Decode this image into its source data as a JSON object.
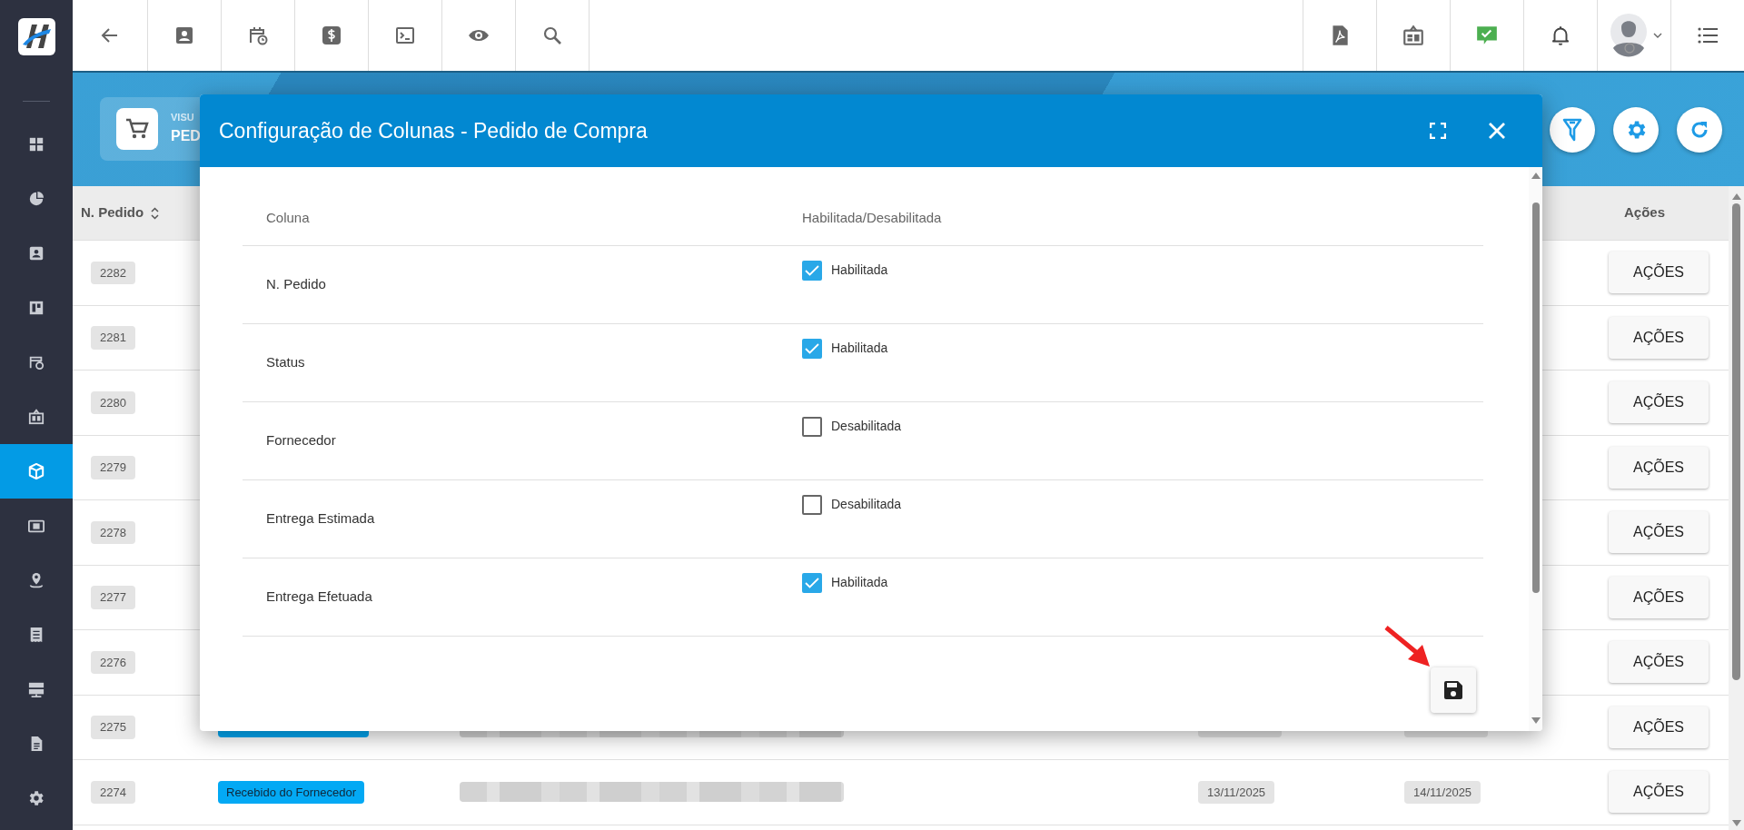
{
  "sidebar": {
    "items": [
      {
        "selected": false
      },
      {
        "selected": false
      },
      {
        "selected": false
      },
      {
        "selected": false
      },
      {
        "selected": false
      },
      {
        "selected": false
      },
      {
        "selected": true
      },
      {
        "selected": false
      },
      {
        "selected": false
      },
      {
        "selected": false
      },
      {
        "selected": false
      },
      {
        "selected": false
      },
      {
        "selected": false
      }
    ]
  },
  "banner": {
    "subtitle": "VISU",
    "title": "PED"
  },
  "table": {
    "columns": [
      "N. Pedido",
      "Ações"
    ],
    "rows": [
      {
        "number": "2282",
        "action": "AÇÕES"
      },
      {
        "number": "2281",
        "action": "AÇÕES"
      },
      {
        "number": "2280",
        "action": "AÇÕES"
      },
      {
        "number": "2279",
        "action": "AÇÕES"
      },
      {
        "number": "2278",
        "action": "AÇÕES"
      },
      {
        "number": "2277",
        "action": "AÇÕES"
      },
      {
        "number": "2276",
        "action": "AÇÕES"
      },
      {
        "number": "2275",
        "action": "AÇÕES",
        "partly_covered": true
      },
      {
        "number": "2274",
        "action": "AÇÕES",
        "status": "Recebido do Fornecedor",
        "estimated": "13/11/2025",
        "delivered": "14/11/2025"
      }
    ]
  },
  "modal": {
    "title": "Configuração de Colunas - Pedido de Compra",
    "columns": [
      "Coluna",
      "Habilitada/Desabilitada"
    ],
    "rows": [
      {
        "column": "N. Pedido",
        "checked": true,
        "state_label": "Habilitada"
      },
      {
        "column": "Status",
        "checked": true,
        "state_label": "Habilitada"
      },
      {
        "column": "Fornecedor",
        "checked": false,
        "state_label": "Desabilitada"
      },
      {
        "column": "Entrega Estimada",
        "checked": false,
        "state_label": "Desabilitada"
      },
      {
        "column": "Entrega Efetuada",
        "checked": true,
        "state_label": "Habilitada"
      }
    ]
  }
}
